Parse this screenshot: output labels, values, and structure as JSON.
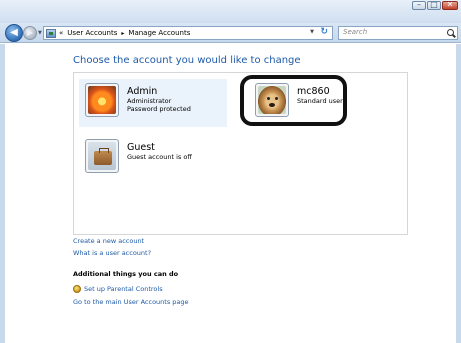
{
  "window": {
    "minimize_glyph": "–",
    "maximize_glyph": "□",
    "close_glyph": "✕"
  },
  "navigation": {
    "back_glyph": "◀",
    "forward_glyph": "▶",
    "breadcrumb_prefix": "«",
    "breadcrumb": [
      "User Accounts",
      "Manage Accounts"
    ],
    "breadcrumb_separator": "▸",
    "dropdown_glyph": "▼",
    "refresh_glyph": "↻",
    "search_placeholder": "Search"
  },
  "page": {
    "title": "Choose the account you would like to change"
  },
  "accounts": [
    {
      "name": "Admin",
      "type": "Administrator",
      "status": "Password protected",
      "picture": "flower-picture"
    },
    {
      "name": "mc860",
      "type": "Standard user",
      "picture": "dog-picture"
    },
    {
      "name": "Guest",
      "type": "Guest account is off",
      "picture": "briefcase-picture"
    }
  ],
  "links": {
    "create_account": "Create a new account",
    "what_is_account": "What is a user account?",
    "additional_heading": "Additional things you can do",
    "parental_controls": "Set up Parental Controls",
    "main_page": "Go to the main User Accounts page"
  },
  "colors": {
    "link": "#1e5aa8",
    "selected_account_bg": "#eaf3fc",
    "highlight_ring": "#111111"
  }
}
